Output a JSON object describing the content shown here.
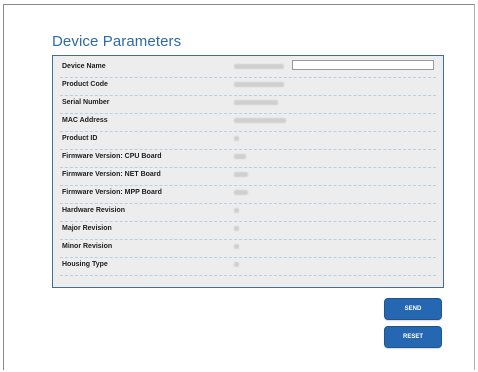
{
  "page": {
    "title": "Device Parameters"
  },
  "parameters": [
    {
      "label": "Device Name",
      "value": "",
      "editable": true
    },
    {
      "label": "Product Code",
      "value": ""
    },
    {
      "label": "Serial Number",
      "value": ""
    },
    {
      "label": "MAC Address",
      "value": ""
    },
    {
      "label": "Product ID",
      "value": ""
    },
    {
      "label": "Firmware Version: CPU Board",
      "value": ""
    },
    {
      "label": "Firmware Version: NET Board",
      "value": ""
    },
    {
      "label": "Firmware Version: MPP Board",
      "value": ""
    },
    {
      "label": "Hardware Revision",
      "value": ""
    },
    {
      "label": "Major Revision",
      "value": ""
    },
    {
      "label": "Minor Revision",
      "value": ""
    },
    {
      "label": "Housing Type",
      "value": ""
    }
  ],
  "actions": {
    "send_label": "SEND",
    "reset_label": "RESET"
  },
  "colors": {
    "accent": "#2567b1",
    "title": "#2e6aa8",
    "panel_bg": "#ededed",
    "panel_border": "#3f6e99"
  }
}
